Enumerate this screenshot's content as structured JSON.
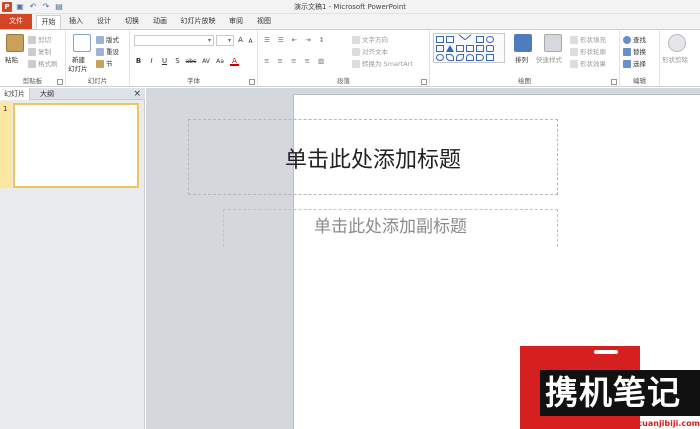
{
  "window": {
    "title": "演示文稿1 - Microsoft PowerPoint",
    "app_icon_label": "P",
    "qat_icons": [
      "save-icon",
      "undo-icon",
      "redo-icon",
      "open-icon"
    ]
  },
  "tabs": [
    "文件",
    "开始",
    "插入",
    "设计",
    "切换",
    "动画",
    "幻灯片放映",
    "审阅",
    "视图"
  ],
  "ribbon": {
    "clipboard": {
      "label": "剪贴板",
      "paste": "粘贴",
      "cut": "剪切",
      "copy": "复制",
      "format_painter": "格式刷"
    },
    "slides": {
      "label": "幻灯片",
      "new_slide": "新建",
      "new_slide_2": "幻灯片",
      "layout": "版式",
      "reset": "重设",
      "section": "节"
    },
    "font": {
      "label": "字体",
      "font_name": "",
      "font_size": "",
      "bold": "B",
      "italic": "I",
      "underline": "U",
      "shadow": "S",
      "strike": "abc",
      "spacing": "AV",
      "case": "Aa",
      "color": "A",
      "grow": "A",
      "shrink": "A",
      "clear": "A"
    },
    "paragraph": {
      "label": "段落",
      "text_direction": "文字方向",
      "align_text": "对齐文本",
      "smartart": "转换为 SmartArt"
    },
    "drawing": {
      "label": "绘图",
      "arrange": "排列",
      "quick_styles": "快速样式",
      "shape_fill": "形状填充",
      "shape_outline": "形状轮廓",
      "shape_effects": "形状效果"
    },
    "editing": {
      "label": "编辑",
      "find": "查找",
      "replace": "替换",
      "select": "选择"
    },
    "extra": {
      "shape_format": "形状剪除",
      "more": "形"
    }
  },
  "left_pane": {
    "tab_slides": "幻灯片",
    "tab_outline": "大纲",
    "close": "×",
    "slide_number": "1"
  },
  "slide": {
    "title_placeholder": "单击此处添加标题",
    "subtitle_placeholder": "单击此处添加副标题"
  },
  "watermark": {
    "text": "携机笔记",
    "url": "www.cuanjibiji.com"
  },
  "colors": {
    "file_tab": "#d24625",
    "thumb_border": "#f2c55c",
    "watermark_red": "#d61f1f"
  }
}
